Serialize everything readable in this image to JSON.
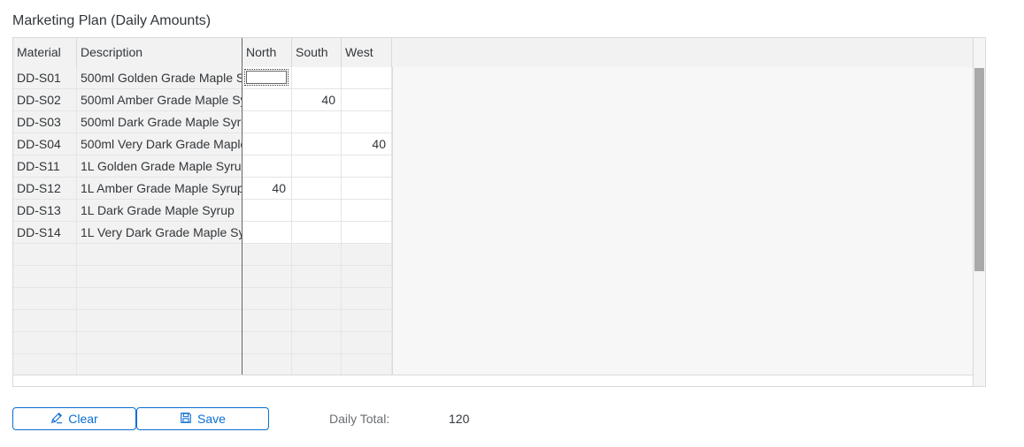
{
  "title": "Marketing Plan (Daily Amounts)",
  "columns": [
    "Material",
    "Description",
    "North",
    "South",
    "West"
  ],
  "rows": [
    {
      "material": "DD-S01",
      "description": "500ml Golden Grade Maple S",
      "north": "",
      "south": "",
      "west": ""
    },
    {
      "material": "DD-S02",
      "description": "500ml Amber Grade Maple Sy",
      "north": "",
      "south": "40",
      "west": ""
    },
    {
      "material": "DD-S03",
      "description": "500ml Dark Grade Maple Syru",
      "north": "",
      "south": "",
      "west": ""
    },
    {
      "material": "DD-S04",
      "description": "500ml Very Dark Grade Maple",
      "north": "",
      "south": "",
      "west": "40"
    },
    {
      "material": "DD-S11",
      "description": "1L Golden Grade Maple Syrup",
      "north": "",
      "south": "",
      "west": ""
    },
    {
      "material": "DD-S12",
      "description": "1L Amber Grade Maple Syrup",
      "north": "40",
      "south": "",
      "west": ""
    },
    {
      "material": "DD-S13",
      "description": "1L Dark Grade Maple Syrup",
      "north": "",
      "south": "",
      "west": ""
    },
    {
      "material": "DD-S14",
      "description": "1L Very Dark Grade Maple Sy",
      "north": "",
      "south": "",
      "west": ""
    }
  ],
  "empty_rows": 6,
  "buttons": {
    "clear": "Clear",
    "save": "Save"
  },
  "icons": {
    "clear": "pencil-icon",
    "save": "save-icon"
  },
  "total": {
    "label": "Daily Total:",
    "value": "120"
  },
  "colors": {
    "accent": "#0a6ed1",
    "header_bg": "#f2f2f2",
    "scroll_thumb": "#a9a9a9"
  }
}
